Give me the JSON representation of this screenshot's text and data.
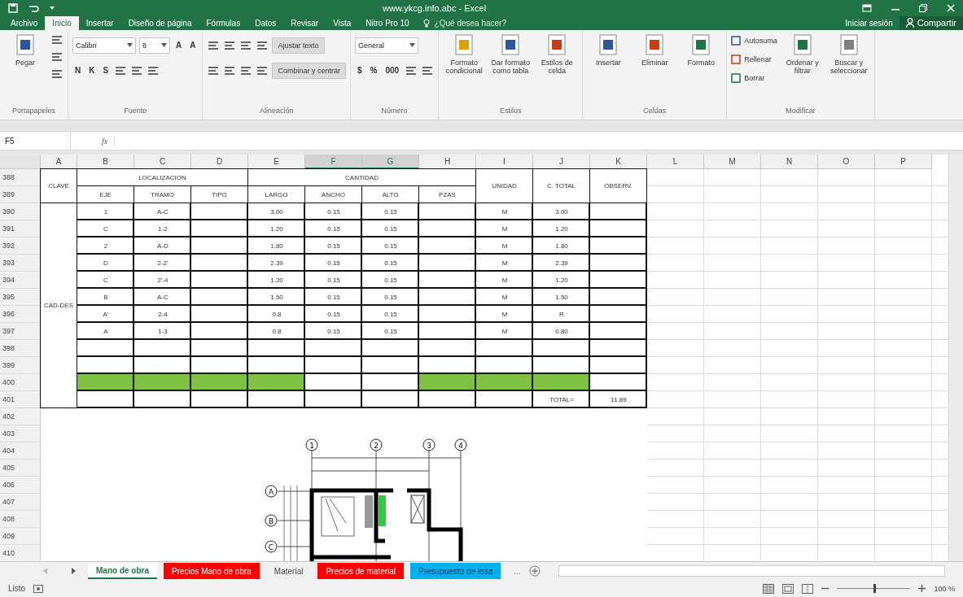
{
  "window": {
    "title": "www.ykcg.info.abc - Excel"
  },
  "menu_tabs": [
    {
      "label": "Archivo",
      "selected": false
    },
    {
      "label": "Inicio",
      "selected": true
    },
    {
      "label": "Insertar",
      "selected": false
    },
    {
      "label": "Diseño de página",
      "selected": false
    },
    {
      "label": "Fórmulas",
      "selected": false
    },
    {
      "label": "Datos",
      "selected": false
    },
    {
      "label": "Revisar",
      "selected": false
    },
    {
      "label": "Vista",
      "selected": false
    },
    {
      "label": "Nitro Pro 10",
      "selected": false
    }
  ],
  "tell_me": {
    "placeholder": "¿Qué desea hacer?"
  },
  "account": {
    "sign_in": "Iniciar sesión",
    "share": "Compartir"
  },
  "ribbon": {
    "groups": [
      {
        "label": "Portapapeles",
        "columns": [
          [
            {
              "kind": "large",
              "label": "Pegar"
            }
          ],
          [
            {
              "kind": "icon"
            },
            {
              "kind": "icon"
            },
            {
              "kind": "icon"
            }
          ]
        ]
      },
      {
        "label": "Fuente",
        "columns": [
          [
            {
              "kind": "line",
              "items": [
                {
                  "kind": "combo",
                  "value": "Calibri"
                },
                {
                  "kind": "combo",
                  "value": "8"
                },
                {
                  "kind": "glyph",
                  "label": "A"
                },
                {
                  "kind": "glyph",
                  "label": "A"
                }
              ]
            },
            {
              "kind": "line",
              "items": [
                {
                  "kind": "glyph",
                  "label": "N"
                },
                {
                  "kind": "glyph",
                  "label": "K"
                },
                {
                  "kind": "glyph",
                  "label": "S"
                },
                {
                  "kind": "icon"
                },
                {
                  "kind": "icon"
                },
                {
                  "kind": "icon"
                }
              ]
            }
          ]
        ]
      },
      {
        "label": "Alineación",
        "columns": [
          [
            {
              "kind": "line",
              "items": [
                {
                  "kind": "icon"
                },
                {
                  "kind": "icon"
                },
                {
                  "kind": "icon"
                },
                {
                  "kind": "icon"
                },
                {
                  "kind": "wide",
                  "label": "Ajustar texto"
                }
              ]
            },
            {
              "kind": "line",
              "items": [
                {
                  "kind": "icon"
                },
                {
                  "kind": "icon"
                },
                {
                  "kind": "icon"
                },
                {
                  "kind": "icon"
                },
                {
                  "kind": "wide",
                  "label": "Combinar y centrar"
                }
              ]
            }
          ]
        ]
      },
      {
        "label": "Número",
        "columns": [
          [
            {
              "kind": "line",
              "items": [
                {
                  "kind": "combo",
                  "value": "General"
                }
              ]
            },
            {
              "kind": "line",
              "items": [
                {
                  "kind": "glyph",
                  "label": "$"
                },
                {
                  "kind": "glyph",
                  "label": "%"
                },
                {
                  "kind": "glyph",
                  "label": "000"
                },
                {
                  "kind": "icon"
                },
                {
                  "kind": "icon"
                }
              ]
            }
          ]
        ]
      },
      {
        "label": "Estilos",
        "columns": [
          [
            {
              "kind": "large",
              "label": "Formato condicional"
            }
          ],
          [
            {
              "kind": "large",
              "label": "Dar formato como tabla"
            }
          ],
          [
            {
              "kind": "large",
              "label": "Estilos de celda"
            }
          ]
        ]
      },
      {
        "label": "Celdas",
        "columns": [
          [
            {
              "kind": "large",
              "label": "Insertar"
            }
          ],
          [
            {
              "kind": "large",
              "label": "Eliminar"
            }
          ],
          [
            {
              "kind": "large",
              "label": "Formato"
            }
          ]
        ]
      },
      {
        "label": "Modificar",
        "columns": [
          [
            {
              "kind": "small",
              "label": "Autosuma"
            },
            {
              "kind": "small",
              "label": "Rellenar"
            },
            {
              "kind": "small",
              "label": "Borrar"
            }
          ],
          [
            {
              "kind": "large",
              "label": "Ordenar y filtrar"
            }
          ],
          [
            {
              "kind": "large",
              "label": "Buscar y seleccionar"
            }
          ]
        ]
      }
    ]
  },
  "formula_bar": {
    "name_box": "F5",
    "fx": "fx"
  },
  "sheet": {
    "columns": [
      {
        "letter": "A",
        "selected": false
      },
      {
        "letter": "B",
        "selected": false
      },
      {
        "letter": "C",
        "selected": false
      },
      {
        "letter": "D",
        "selected": false
      },
      {
        "letter": "E",
        "selected": false
      },
      {
        "letter": "F",
        "selected": true
      },
      {
        "letter": "G",
        "selected": true
      },
      {
        "letter": "H",
        "selected": false
      },
      {
        "letter": "I",
        "selected": false
      },
      {
        "letter": "J",
        "selected": false
      },
      {
        "letter": "K",
        "selected": false
      },
      {
        "letter": "L",
        "selected": false
      },
      {
        "letter": "M",
        "selected": false
      },
      {
        "letter": "N",
        "selected": false
      },
      {
        "letter": "O",
        "selected": false
      },
      {
        "letter": "P",
        "selected": false
      }
    ],
    "rows": [
      "388",
      "389",
      "390",
      "391",
      "392",
      "393",
      "394",
      "395",
      "396",
      "397",
      "398",
      "399",
      "400",
      "401",
      "402",
      "403",
      "404",
      "405",
      "406",
      "407",
      "408",
      "409",
      "410"
    ],
    "table": {
      "key_header": "CLAVE",
      "groups": [
        {
          "label": "LOCALIZACION",
          "columns": [
            "EJE",
            "TRAMO",
            "TIPO"
          ]
        },
        {
          "label": "CANTIDAD",
          "columns": [
            "LARGO",
            "ANCHO",
            "ALTO",
            "PZAS"
          ]
        }
      ],
      "tail_headers": [
        "UNIDAD",
        "C. TOTAL",
        "OBSERV."
      ],
      "key_value": "CAD-DES",
      "rows": [
        [
          {
            "text": "1"
          },
          {
            "text": "A-C"
          },
          {},
          {
            "text": "3.00"
          },
          {
            "text": "0.15"
          },
          {
            "text": "0.15"
          },
          {},
          {
            "text": "M"
          },
          {
            "text": "3.00"
          },
          {}
        ],
        [
          {
            "text": "C"
          },
          {
            "text": "1-2"
          },
          {},
          {
            "text": "1.20"
          },
          {
            "text": "0.15"
          },
          {
            "text": "0.15"
          },
          {},
          {
            "text": "M"
          },
          {
            "text": "1.20"
          },
          {}
        ],
        [
          {
            "text": "2"
          },
          {
            "text": "A-D"
          },
          {},
          {
            "text": "1.80"
          },
          {
            "text": "0.15"
          },
          {
            "text": "0.15"
          },
          {},
          {
            "text": "M"
          },
          {
            "text": "1.80"
          },
          {}
        ],
        [
          {
            "text": "D"
          },
          {
            "text": "2-2'"
          },
          {},
          {
            "text": "2.39"
          },
          {
            "text": "0.15"
          },
          {
            "text": "0.15"
          },
          {},
          {
            "text": "M"
          },
          {
            "text": "2.39"
          },
          {}
        ],
        [
          {
            "text": "C"
          },
          {
            "text": "2'-4"
          },
          {},
          {
            "text": "1.20"
          },
          {
            "text": "0.15"
          },
          {
            "text": "0.15"
          },
          {},
          {
            "text": "M"
          },
          {
            "text": "1.20"
          },
          {}
        ],
        [
          {
            "text": "B"
          },
          {
            "text": "A-C"
          },
          {},
          {
            "text": "1.50"
          },
          {
            "text": "0.15"
          },
          {
            "text": "0.15"
          },
          {},
          {
            "text": "M"
          },
          {
            "text": "1.50"
          },
          {}
        ],
        [
          {
            "text": "A'"
          },
          {
            "text": "2-4"
          },
          {},
          {
            "text": "0.8"
          },
          {
            "text": "0.15"
          },
          {
            "text": "0.15"
          },
          {},
          {
            "text": "M"
          },
          {
            "text": "R"
          },
          {}
        ],
        [
          {
            "text": "A"
          },
          {
            "text": "1-3"
          },
          {},
          {
            "text": "0.8"
          },
          {
            "text": "0.15"
          },
          {
            "text": "0.15"
          },
          {},
          {
            "text": "M"
          },
          {
            "text": "0.80"
          },
          {}
        ],
        [
          {},
          {},
          {},
          {},
          {},
          {},
          {},
          {},
          {},
          {}
        ],
        [
          {},
          {},
          {},
          {},
          {},
          {},
          {},
          {},
          {},
          {}
        ],
        [
          {
            "filled": true
          },
          {
            "filled": true
          },
          {
            "filled": true
          },
          {
            "filled": true
          },
          {},
          {},
          {
            "filled": true
          },
          {
            "filled": true
          },
          {
            "filled": true
          },
          {}
        ]
      ],
      "total_label": "TOTAL=",
      "total": "11.89"
    },
    "plan": {
      "column_axes": [
        "1",
        "2",
        "3",
        "4"
      ],
      "row_axes": [
        "A",
        "B",
        "C"
      ]
    }
  },
  "sheet_tabs": [
    {
      "label": "Mano de obra",
      "selected": true
    },
    {
      "label": "Precios Mano de obra",
      "selected": false,
      "color": "#ff0000"
    },
    {
      "label": "Material",
      "selected": false
    },
    {
      "label": "Precios de material",
      "selected": false,
      "color": "#ff0000"
    },
    {
      "label": "Presupuesto de losa",
      "selected": false,
      "color": "#00b0f0"
    }
  ],
  "more_tabs": "...",
  "status_bar": {
    "text": "Listo",
    "zoom": {
      "level": 0.5,
      "reading": "100 %"
    }
  }
}
